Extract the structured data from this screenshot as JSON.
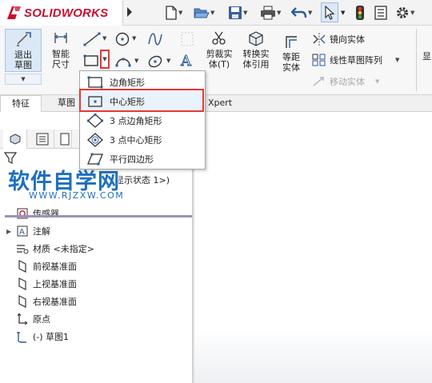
{
  "app": {
    "logo_text": "SOLIDWORKS",
    "brand_color": "#c8102e",
    "highlight_color": "#e53935"
  },
  "quick_access": [
    "new-icon",
    "open-icon",
    "save-icon",
    "print-icon",
    "undo-icon",
    "select-icon",
    "traffic-light-icon",
    "file-properties-icon",
    "options-gear-icon"
  ],
  "ribbon": {
    "exit_sketch": "退出草图",
    "smart_dimension": "智能尺寸",
    "trim_entities": "剪裁实体(T)",
    "convert_entities": "转换实体引用",
    "offset_entities": "等距实体",
    "mirror_entities": "镜向实体",
    "linear_pattern": "线性草图阵列",
    "move_entities": "移动实体"
  },
  "tabs": {
    "feature": "特征",
    "sketch": "草图",
    "xpert": "Xpert"
  },
  "rect_menu": {
    "items": [
      {
        "label": "边角矩形",
        "icon": "corner-rectangle-icon"
      },
      {
        "label": "中心矩形",
        "icon": "center-rectangle-icon"
      },
      {
        "label": "3 点边角矩形",
        "icon": "3-point-corner-rectangle-icon"
      },
      {
        "label": "3 点中心矩形",
        "icon": "3-point-center-rectangle-icon"
      },
      {
        "label": "平行四边形",
        "icon": "parallelogram-icon"
      }
    ],
    "highlighted_index": 1
  },
  "watermark": {
    "text": "软件自学网",
    "url": "WWW.RJZXW.COM"
  },
  "feature_tree": {
    "config_text": "显示状态 1>)",
    "items": [
      {
        "label": "传感器",
        "icon": "sensor-icon",
        "expandable": false
      },
      {
        "label": "注解",
        "icon": "annotation-icon",
        "expandable": true
      },
      {
        "label": "材质 <未指定>",
        "icon": "material-icon",
        "expandable": false
      },
      {
        "label": "前视基准面",
        "icon": "plane-icon",
        "expandable": false
      },
      {
        "label": "上视基准面",
        "icon": "plane-icon",
        "expandable": false
      },
      {
        "label": "右视基准面",
        "icon": "plane-icon",
        "expandable": false
      },
      {
        "label": "原点",
        "icon": "origin-icon",
        "expandable": false
      },
      {
        "label": "(-) 草图1",
        "icon": "sketch-icon",
        "expandable": false
      }
    ]
  }
}
